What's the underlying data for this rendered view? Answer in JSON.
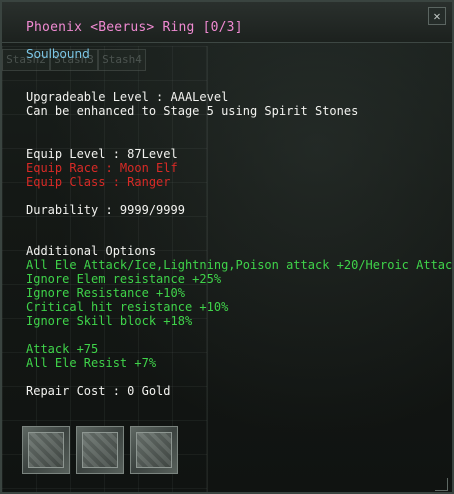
{
  "title": "Phoenix <Beerus> Ring [0/3]",
  "close_icon": "✕",
  "soulbound": "Soulbound",
  "bg_tabs": [
    "Stash2",
    "Stash3",
    "Stash4"
  ],
  "upgrade": {
    "level": "Upgradeable Level : AAALevel",
    "enhance": "Can be enhanced to Stage 5 using Spirit Stones"
  },
  "requirements": {
    "level": "Equip Level :  87Level",
    "race": "Equip Race :  Moon Elf",
    "class": "Equip Class :   Ranger"
  },
  "durability": "Durability : 9999/9999",
  "options": {
    "header": "Additional Options",
    "lines": [
      "All Ele Attack/Ice,Lightning,Poison attack  +20/Heroic Attack+20",
      "Ignore Elem resistance +25%",
      "Ignore Resistance  +10%",
      "Critical hit resistance +10%",
      "Ignore Skill block +18%"
    ]
  },
  "bonus": {
    "attack": "Attack +75",
    "resist": "All Ele Resist +7%"
  },
  "repair_cost": "Repair Cost : 0 Gold",
  "sockets": [
    "empty-socket",
    "empty-socket",
    "empty-socket"
  ]
}
